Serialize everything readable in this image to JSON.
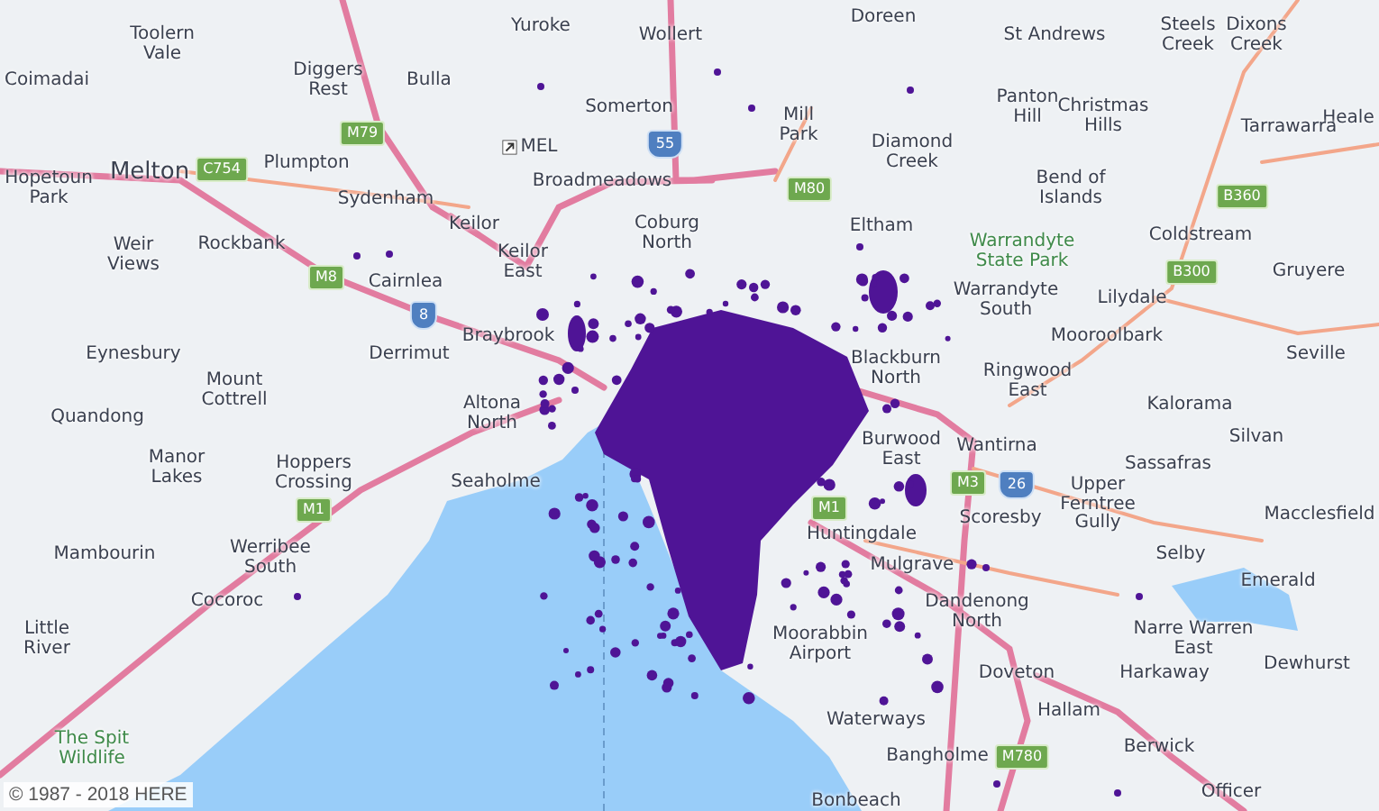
{
  "map": {
    "labels": [
      {
        "text": "Toolern Vale",
        "kind": "place"
      },
      {
        "text": "Coimadai",
        "kind": "place"
      },
      {
        "text": "Diggers Rest",
        "kind": "place"
      },
      {
        "text": "Bulla",
        "kind": "place"
      },
      {
        "text": "Yuroke",
        "kind": "place"
      },
      {
        "text": "Wollert",
        "kind": "place"
      },
      {
        "text": "Doreen",
        "kind": "place"
      },
      {
        "text": "St Andrews",
        "kind": "place"
      },
      {
        "text": "Steels Creek",
        "kind": "place"
      },
      {
        "text": "Dixons Creek",
        "kind": "place"
      },
      {
        "text": "Heale",
        "kind": "place"
      },
      {
        "text": "Somerton",
        "kind": "place"
      },
      {
        "text": "MEL",
        "kind": "airport"
      },
      {
        "text": "Melton",
        "kind": "major"
      },
      {
        "text": "Plumpton",
        "kind": "place"
      },
      {
        "text": "Hopetoun Park",
        "kind": "place"
      },
      {
        "text": "Broadmeadows",
        "kind": "place"
      },
      {
        "text": "Sydenham",
        "kind": "place"
      },
      {
        "text": "Mill Park",
        "kind": "place"
      },
      {
        "text": "Panton Hill",
        "kind": "place"
      },
      {
        "text": "Christmas Hills",
        "kind": "place"
      },
      {
        "text": "Tarrawarra",
        "kind": "place"
      },
      {
        "text": "Diamond Creek",
        "kind": "place"
      },
      {
        "text": "Bend of Islands",
        "kind": "place"
      },
      {
        "text": "Keilor",
        "kind": "place"
      },
      {
        "text": "Coburg North",
        "kind": "place"
      },
      {
        "text": "Eltham",
        "kind": "place"
      },
      {
        "text": "Weir Views",
        "kind": "place"
      },
      {
        "text": "Rockbank",
        "kind": "place"
      },
      {
        "text": "Keilor East",
        "kind": "place"
      },
      {
        "text": "Warrandyte State Park",
        "kind": "park"
      },
      {
        "text": "Coldstream",
        "kind": "place"
      },
      {
        "text": "Gruyere",
        "kind": "place"
      },
      {
        "text": "Cairnlea",
        "kind": "place"
      },
      {
        "text": "Warrandyte South",
        "kind": "place"
      },
      {
        "text": "Lilydale",
        "kind": "place"
      },
      {
        "text": "Braybrook",
        "kind": "place"
      },
      {
        "text": "Eynesbury",
        "kind": "place"
      },
      {
        "text": "Derrimut",
        "kind": "place"
      },
      {
        "text": "Blackburn North",
        "kind": "place"
      },
      {
        "text": "Mooroolbark",
        "kind": "place"
      },
      {
        "text": "Seville",
        "kind": "place"
      },
      {
        "text": "Ringwood East",
        "kind": "place"
      },
      {
        "text": "Mount Cottrell",
        "kind": "place"
      },
      {
        "text": "Quandong",
        "kind": "place"
      },
      {
        "text": "Altona North",
        "kind": "place"
      },
      {
        "text": "Kalorama",
        "kind": "place"
      },
      {
        "text": "Silvan",
        "kind": "place"
      },
      {
        "text": "Burwood East",
        "kind": "place"
      },
      {
        "text": "Wantirna",
        "kind": "place"
      },
      {
        "text": "Manor Lakes",
        "kind": "place"
      },
      {
        "text": "Hoppers Crossing",
        "kind": "place"
      },
      {
        "text": "Seaholme",
        "kind": "place"
      },
      {
        "text": "Sassafras",
        "kind": "place"
      },
      {
        "text": "Scoresby",
        "kind": "place"
      },
      {
        "text": "Upper Ferntree Gully",
        "kind": "place"
      },
      {
        "text": "Macclesfield",
        "kind": "place"
      },
      {
        "text": "Mambourin",
        "kind": "place"
      },
      {
        "text": "Werribee South",
        "kind": "place"
      },
      {
        "text": "Huntingdale",
        "kind": "place"
      },
      {
        "text": "Mulgrave",
        "kind": "place"
      },
      {
        "text": "Selby",
        "kind": "place"
      },
      {
        "text": "Emerald",
        "kind": "place"
      },
      {
        "text": "Cocoroc",
        "kind": "place"
      },
      {
        "text": "Little River",
        "kind": "place"
      },
      {
        "text": "Dandenong North",
        "kind": "place"
      },
      {
        "text": "Moorabbin Airport",
        "kind": "place"
      },
      {
        "text": "Narre Warren East",
        "kind": "place"
      },
      {
        "text": "Doveton",
        "kind": "place"
      },
      {
        "text": "Harkaway",
        "kind": "place"
      },
      {
        "text": "Dewhurst",
        "kind": "place"
      },
      {
        "text": "The Spit Wildlife",
        "kind": "park"
      },
      {
        "text": "Waterways",
        "kind": "place"
      },
      {
        "text": "Hallam",
        "kind": "place"
      },
      {
        "text": "Bangholme",
        "kind": "place"
      },
      {
        "text": "Berwick",
        "kind": "place"
      },
      {
        "text": "Bonbeach",
        "kind": "place"
      },
      {
        "text": "Officer",
        "kind": "place"
      }
    ],
    "route_signs": [
      {
        "text": "M79",
        "kind": "green"
      },
      {
        "text": "C754",
        "kind": "green"
      },
      {
        "text": "M8",
        "kind": "green"
      },
      {
        "text": "8",
        "kind": "blue"
      },
      {
        "text": "55",
        "kind": "blue"
      },
      {
        "text": "M80",
        "kind": "green"
      },
      {
        "text": "B360",
        "kind": "green"
      },
      {
        "text": "B300",
        "kind": "green"
      },
      {
        "text": "M3",
        "kind": "green"
      },
      {
        "text": "26",
        "kind": "blue"
      },
      {
        "text": "M1",
        "kind": "green"
      },
      {
        "text": "M1",
        "kind": "green"
      },
      {
        "text": "M780",
        "kind": "green"
      }
    ],
    "attribution": "© 1987 - 2018 HERE"
  }
}
